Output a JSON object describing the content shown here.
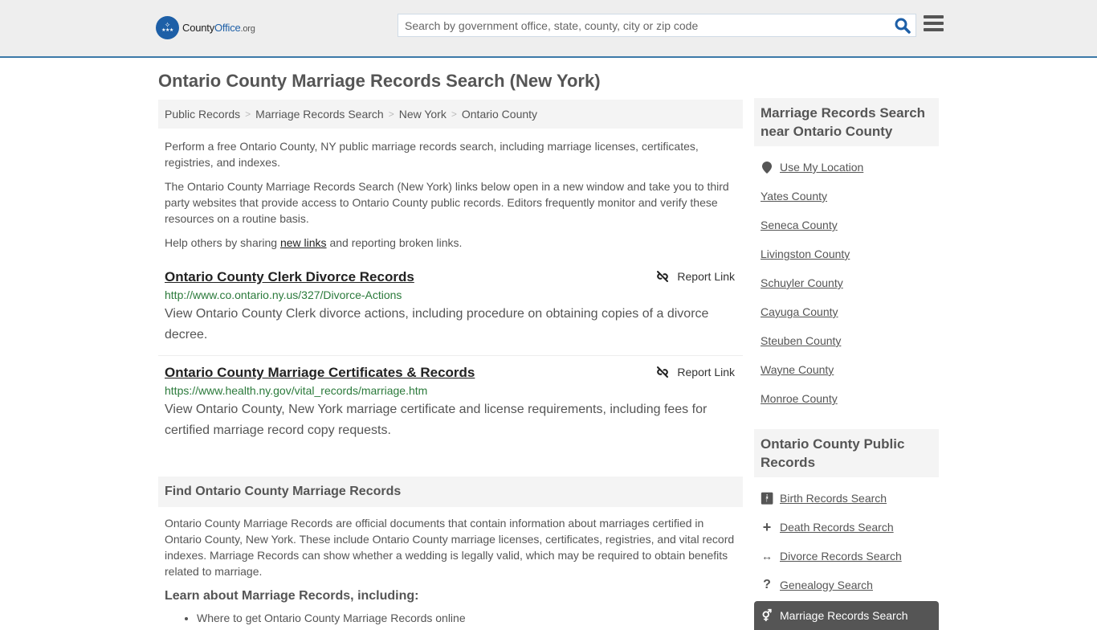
{
  "header": {
    "logo": {
      "part1": "County",
      "part2": "Office",
      "part3": ".org"
    },
    "search_placeholder": "Search by government office, state, county, city or zip code",
    "icons": {
      "search": "search-icon",
      "menu": "hamburger-menu-icon",
      "logo": "eagle-stars-badge"
    }
  },
  "page_title": "Ontario County Marriage Records Search (New York)",
  "breadcrumb": [
    "Public Records",
    "Marriage Records Search",
    "New York",
    "Ontario County"
  ],
  "breadcrumb_separator": ">",
  "intro": {
    "p1": "Perform a free Ontario County, NY public marriage records search, including marriage licenses, certificates, registries, and indexes.",
    "p2": "The Ontario County Marriage Records Search (New York) links below open in a new window and take you to third party websites that provide access to Ontario County public records. Editors frequently monitor and verify these resources on a routine basis.",
    "p3_before": "Help others by sharing ",
    "p3_link": "new links",
    "p3_after": " and reporting broken links."
  },
  "results": [
    {
      "title": "Ontario County Clerk Divorce Records",
      "url": "http://www.co.ontario.ny.us/327/Divorce-Actions",
      "description": "View Ontario County Clerk divorce actions, including procedure on obtaining copies of a divorce decree.",
      "report_label": "Report Link"
    },
    {
      "title": "Ontario County Marriage Certificates & Records",
      "url": "https://www.health.ny.gov/vital_records/marriage.htm",
      "description": "View Ontario County, New York marriage certificate and license requirements, including fees for certified marriage record copy requests.",
      "report_label": "Report Link"
    }
  ],
  "find_section": {
    "heading": "Find Ontario County Marriage Records",
    "body": "Ontario County Marriage Records are official documents that contain information about marriages certified in Ontario County, New York. These include Ontario County marriage licenses, certificates, registries, and vital record indexes. Marriage Records can show whether a wedding is legally valid, which may be required to obtain benefits related to marriage.",
    "learn_heading": "Learn about Marriage Records, including:",
    "learn_items": [
      "Where to get Ontario County Marriage Records online"
    ]
  },
  "sidebar": {
    "nearby_heading": "Marriage Records Search near Ontario County",
    "use_location": "Use My Location",
    "nearby": [
      "Yates County",
      "Seneca County",
      "Livingston County",
      "Schuyler County",
      "Cayuga County",
      "Steuben County",
      "Wayne County",
      "Monroe County"
    ],
    "records_heading": "Ontario County Public Records",
    "records": [
      {
        "label": "Birth Records Search",
        "icon": "baby-icon"
      },
      {
        "label": "Death Records Search",
        "icon": "cross-icon"
      },
      {
        "label": "Divorce Records Search",
        "icon": "arrows-horizontal-icon"
      },
      {
        "label": "Genealogy Search",
        "icon": "question-icon"
      },
      {
        "label": "Marriage Records Search",
        "icon": "marriage-symbol-icon",
        "active": true
      }
    ]
  },
  "colors": {
    "header_bg": "#eeeeee",
    "header_border": "#3c79a8",
    "brand_blue": "#1d5fa7",
    "url_green": "#2b7a3b",
    "panel_bg": "#f4f4f4",
    "active_bg": "#555555"
  }
}
